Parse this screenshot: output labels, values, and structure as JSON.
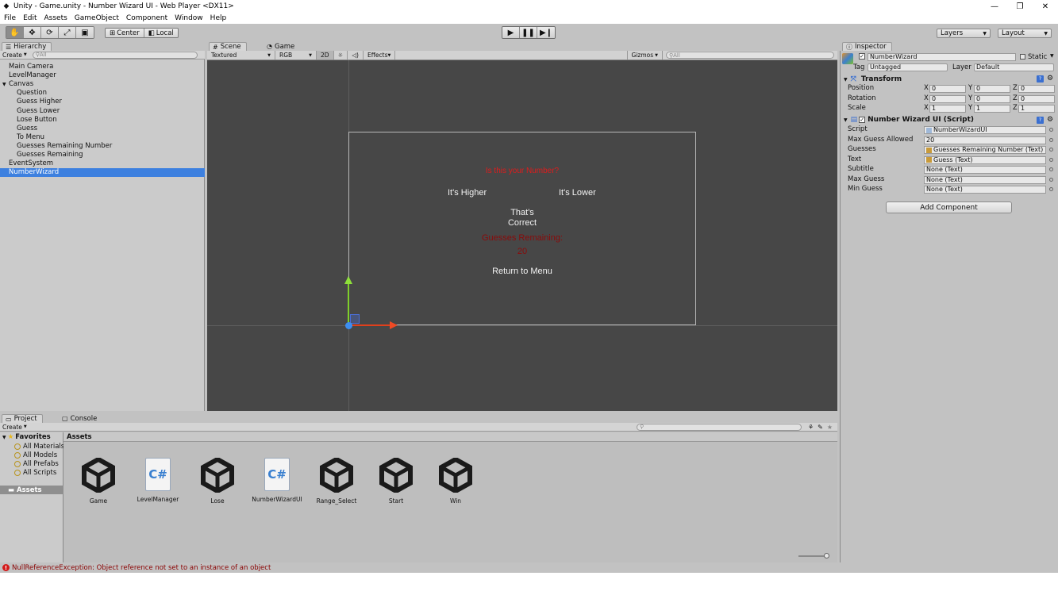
{
  "window": {
    "title": "Unity - Game.unity - Number Wizard UI - Web Player <DX11>",
    "controls": [
      "—",
      "❐",
      "✕"
    ]
  },
  "menu": [
    "File",
    "Edit",
    "Assets",
    "GameObject",
    "Component",
    "Window",
    "Help"
  ],
  "toolbar": {
    "pivot": "Center",
    "space": "Local",
    "layers": "Layers",
    "layout": "Layout"
  },
  "hierarchy": {
    "tab": "Hierarchy",
    "create": "Create",
    "search_placeholder": "All",
    "items": [
      {
        "label": "Main Camera",
        "indent": 0
      },
      {
        "label": "LevelManager",
        "indent": 0
      },
      {
        "label": "Canvas",
        "indent": 0,
        "expanded": true
      },
      {
        "label": "Question",
        "indent": 1
      },
      {
        "label": "Guess Higher",
        "indent": 1
      },
      {
        "label": "Guess Lower",
        "indent": 1
      },
      {
        "label": "Lose Button",
        "indent": 1
      },
      {
        "label": "Guess",
        "indent": 1
      },
      {
        "label": "To Menu",
        "indent": 1
      },
      {
        "label": "Guesses Remaining Number",
        "indent": 1
      },
      {
        "label": "Guesses Remaining",
        "indent": 1
      },
      {
        "label": "EventSystem",
        "indent": 0
      },
      {
        "label": "NumberWizard",
        "indent": 0,
        "selected": true
      }
    ]
  },
  "scene": {
    "tabs": [
      "Scene",
      "Game"
    ],
    "shading": "Textured",
    "render": "RGB",
    "mode_2d": "2D",
    "effects": "Effects",
    "gizmos": "Gizmos",
    "search_placeholder": "All",
    "texts": {
      "question": "Is this your Number?",
      "higher": "It's Higher",
      "lower": "It's Lower",
      "correct_line1": "That's",
      "correct_line2": "Correct",
      "remaining_label": "Guesses Remaining:",
      "remaining_value": "20",
      "menu": "Return to Menu"
    }
  },
  "inspector": {
    "tab": "Inspector",
    "object_name": "NumberWizard",
    "static_label": "Static",
    "tag_label": "Tag",
    "tag_value": "Untagged",
    "layer_label": "Layer",
    "layer_value": "Default",
    "transform": {
      "header": "Transform",
      "rows": [
        {
          "label": "Position",
          "x": "0",
          "y": "0",
          "z": "0"
        },
        {
          "label": "Rotation",
          "x": "0",
          "y": "0",
          "z": "0"
        },
        {
          "label": "Scale",
          "x": "1",
          "y": "1",
          "z": "1"
        }
      ],
      "axis_labels": [
        "X",
        "Y",
        "Z"
      ]
    },
    "script_component": {
      "header": "Number Wizard UI (Script)",
      "fields": [
        {
          "label": "Script",
          "value": "NumberWizardUI",
          "icon": true
        },
        {
          "label": "Max Guess Allowed",
          "value": "20",
          "icon": false
        },
        {
          "label": "Guesses",
          "value": "Guesses Remaining Number (Text)",
          "icon": true
        },
        {
          "label": "Text",
          "value": "Guess (Text)",
          "icon": true
        },
        {
          "label": "Subtitle",
          "value": "None (Text)",
          "icon": false
        },
        {
          "label": "Max Guess",
          "value": "None (Text)",
          "icon": false
        },
        {
          "label": "Min Guess",
          "value": "None (Text)",
          "icon": false
        }
      ]
    },
    "add_component": "Add Component"
  },
  "project": {
    "tabs": [
      "Project",
      "Console"
    ],
    "create": "Create",
    "favorites_label": "Favorites",
    "favorites": [
      "All Materials",
      "All Models",
      "All Prefabs",
      "All Scripts"
    ],
    "assets_root": "Assets",
    "breadcrumb": "Assets",
    "assets": [
      {
        "name": "Game",
        "kind": "unity"
      },
      {
        "name": "LevelManager",
        "kind": "script"
      },
      {
        "name": "Lose",
        "kind": "unity"
      },
      {
        "name": "NumberWizardUI",
        "kind": "script"
      },
      {
        "name": "Range_Select",
        "kind": "unity"
      },
      {
        "name": "Start",
        "kind": "unity"
      },
      {
        "name": "Win",
        "kind": "unity"
      }
    ]
  },
  "status": {
    "message": "NullReferenceException: Object reference not set to an instance of an object",
    "level": "error",
    "color": "#8a0000"
  },
  "colors": {
    "selection": "#3d80df",
    "scene_bg": "#474747",
    "question_text": "#e01c1c",
    "remaining_text": "#8a0a0a"
  }
}
